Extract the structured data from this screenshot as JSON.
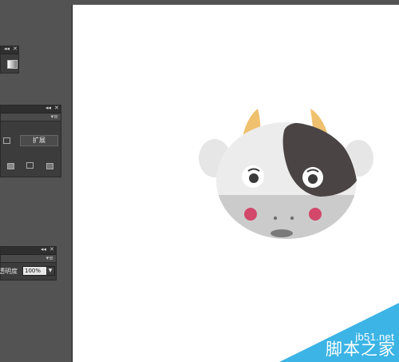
{
  "panels": {
    "top": {
      "close_glyph": "✕",
      "collapse_glyph": "◂◂"
    },
    "pathfinder": {
      "close_glyph": "✕",
      "collapse_glyph": "◂◂",
      "menu_glyph": "▾≡",
      "expand_label": "扩展"
    },
    "transparency": {
      "close_glyph": "✕",
      "collapse_glyph": "◂◂",
      "menu_glyph": "▾≡",
      "opacity_label": "透明度",
      "opacity_value": "100%"
    }
  },
  "artboard": {
    "illustration": "cow-face"
  },
  "watermark": {
    "url": "jb51.net",
    "site_name": "脚本之家",
    "color": "#3cb4e6"
  },
  "colors": {
    "horn": "#efc06e",
    "ear": "#e6e6e6",
    "face": "#ececec",
    "muzzle": "#cbcbcb",
    "spot": "#4a4444",
    "cheek": "#d2476a",
    "eye": "#3a3a3a"
  }
}
